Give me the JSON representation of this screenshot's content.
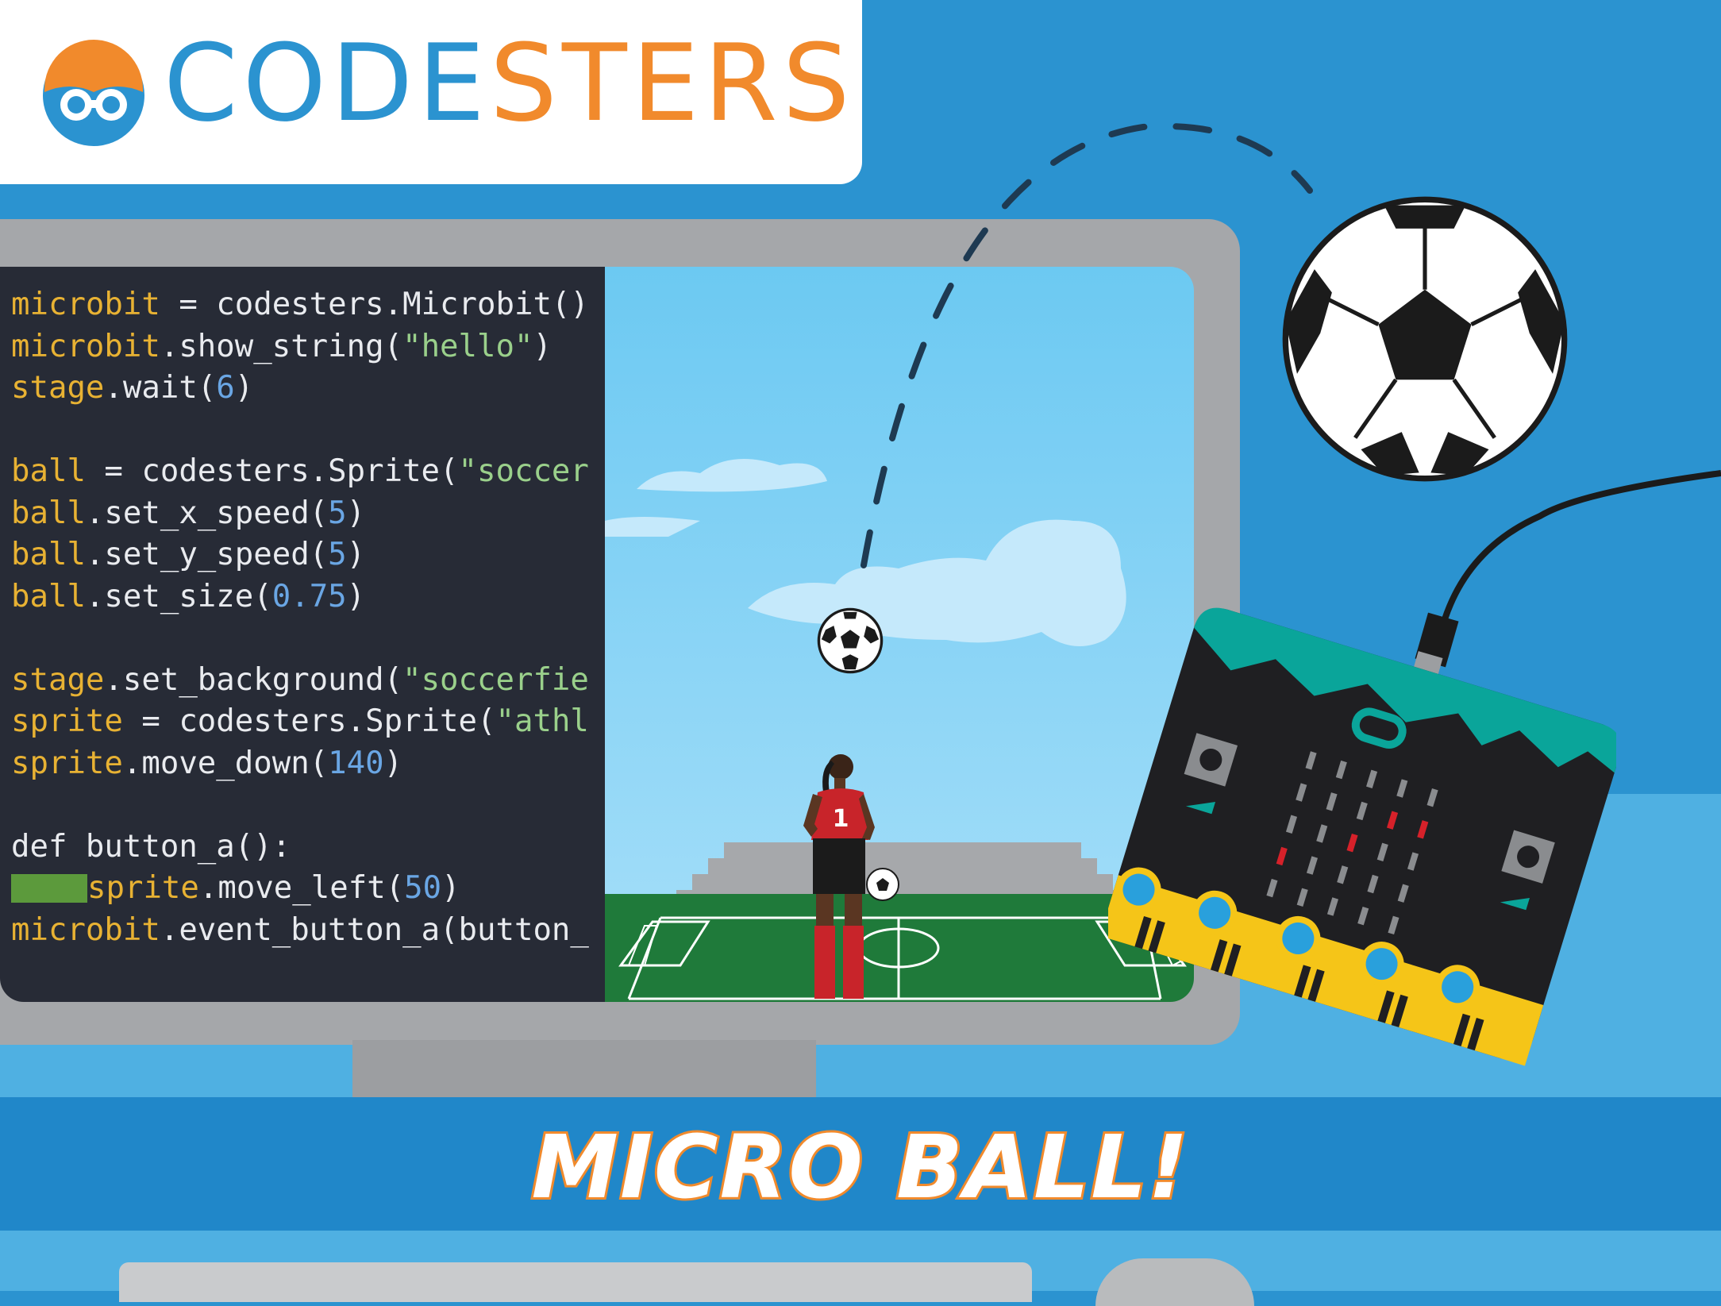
{
  "brand": {
    "name_part1": "CODE",
    "name_part2": "STERS",
    "color_blue": "#2b93d0",
    "color_orange": "#f18a2c"
  },
  "code_lines": [
    [
      {
        "t": "microbit",
        "c": "var"
      },
      {
        "t": " = codesters.Microbit()",
        "c": "plain"
      }
    ],
    [
      {
        "t": "microbit",
        "c": "var"
      },
      {
        "t": ".show_string(",
        "c": "plain"
      },
      {
        "t": "\"hello\"",
        "c": "str"
      },
      {
        "t": ")",
        "c": "plain"
      }
    ],
    [
      {
        "t": "stage",
        "c": "var"
      },
      {
        "t": ".wait(",
        "c": "plain"
      },
      {
        "t": "6",
        "c": "num"
      },
      {
        "t": ")",
        "c": "plain"
      }
    ],
    [],
    [
      {
        "t": "ball",
        "c": "var"
      },
      {
        "t": " = codesters.Sprite(",
        "c": "plain"
      },
      {
        "t": "\"soccer",
        "c": "str"
      }
    ],
    [
      {
        "t": "ball",
        "c": "var"
      },
      {
        "t": ".set_x_speed(",
        "c": "plain"
      },
      {
        "t": "5",
        "c": "num"
      },
      {
        "t": ")",
        "c": "plain"
      }
    ],
    [
      {
        "t": "ball",
        "c": "var"
      },
      {
        "t": ".set_y_speed(",
        "c": "plain"
      },
      {
        "t": "5",
        "c": "num"
      },
      {
        "t": ")",
        "c": "plain"
      }
    ],
    [
      {
        "t": "ball",
        "c": "var"
      },
      {
        "t": ".set_size(",
        "c": "plain"
      },
      {
        "t": "0.75",
        "c": "num"
      },
      {
        "t": ")",
        "c": "plain"
      }
    ],
    [],
    [
      {
        "t": "stage",
        "c": "var"
      },
      {
        "t": ".set_background(",
        "c": "plain"
      },
      {
        "t": "\"soccerfie",
        "c": "str"
      }
    ],
    [
      {
        "t": "sprite",
        "c": "var"
      },
      {
        "t": " = codesters.Sprite(",
        "c": "plain"
      },
      {
        "t": "\"athl",
        "c": "str"
      }
    ],
    [
      {
        "t": "sprite",
        "c": "var"
      },
      {
        "t": ".move_down(",
        "c": "plain"
      },
      {
        "t": "140",
        "c": "num"
      },
      {
        "t": ")",
        "c": "plain"
      }
    ],
    [],
    [
      {
        "t": "def button_a():",
        "c": "plain"
      }
    ],
    [
      {
        "t": "",
        "c": "indent"
      },
      {
        "t": "sprite",
        "c": "var"
      },
      {
        "t": ".move_left(",
        "c": "plain"
      },
      {
        "t": "50",
        "c": "num"
      },
      {
        "t": ")",
        "c": "plain"
      }
    ],
    [
      {
        "t": "microbit",
        "c": "var"
      },
      {
        "t": ".event_button_a(button_",
        "c": "plain"
      }
    ]
  ],
  "player_number": "1",
  "banner_title": "MICRO BALL!",
  "icons": {
    "logo": "codesters-logo-icon",
    "big_ball": "soccer-ball-icon",
    "stage_ball": "soccer-ball-icon",
    "board": "microbit-board-icon"
  }
}
